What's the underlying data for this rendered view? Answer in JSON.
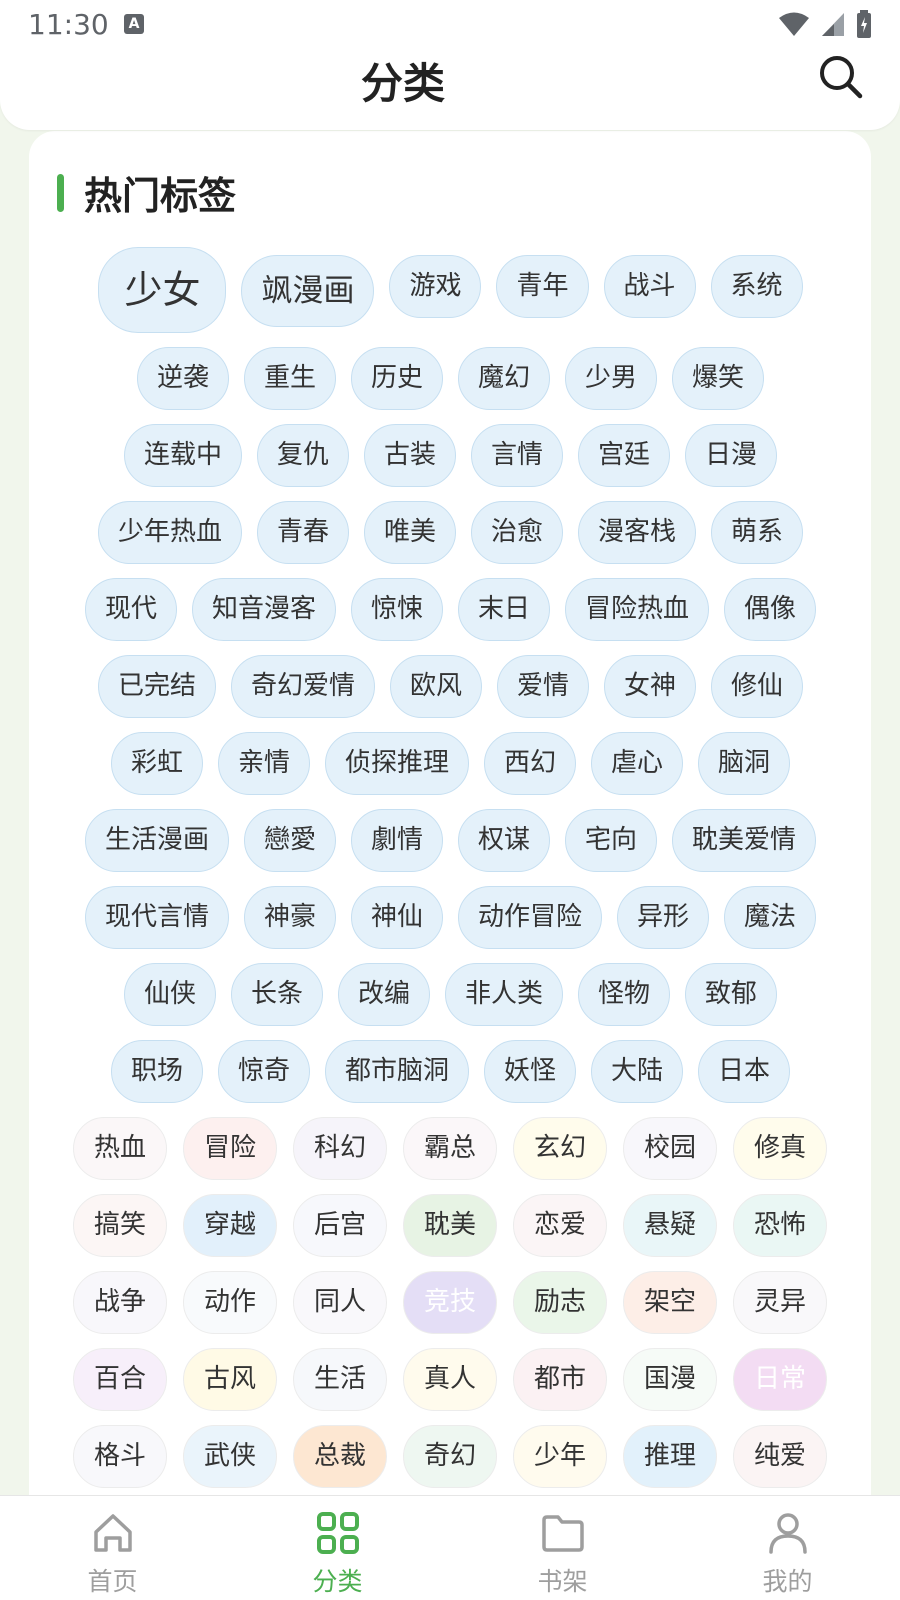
{
  "status": {
    "time": "11:30",
    "app_icon_letter": "A"
  },
  "header": {
    "title": "分类"
  },
  "section": {
    "title": "热门标签"
  },
  "hot_tags": [
    "少女",
    "飒漫画",
    "游戏",
    "青年",
    "战斗",
    "系统",
    "逆袭",
    "重生",
    "历史",
    "魔幻",
    "少男",
    "爆笑",
    "连载中",
    "复仇",
    "古装",
    "言情",
    "宫廷",
    "日漫",
    "少年热血",
    "青春",
    "唯美",
    "治愈",
    "漫客栈",
    "萌系",
    "现代",
    "知音漫客",
    "惊悚",
    "末日",
    "冒险热血",
    "偶像",
    "已完结",
    "奇幻爱情",
    "欧风",
    "爱情",
    "女神",
    "修仙",
    "彩虹",
    "亲情",
    "侦探推理",
    "西幻",
    "虐心",
    "脑洞",
    "生活漫画",
    "戀愛",
    "劇情",
    "权谋",
    "宅向",
    "耽美爱情",
    "现代言情",
    "神豪",
    "神仙",
    "动作冒险",
    "异形",
    "魔法",
    "仙侠",
    "长条",
    "改编",
    "非人类",
    "怪物",
    "致郁",
    "职场",
    "惊奇",
    "都市脑洞",
    "妖怪",
    "大陆",
    "日本"
  ],
  "genre_tags": [
    {
      "label": "热血",
      "bg": "#fbf7f8",
      "fg": "#333333"
    },
    {
      "label": "冒险",
      "bg": "#fdf0ef",
      "fg": "#333333"
    },
    {
      "label": "科幻",
      "bg": "#f6f4fa",
      "fg": "#333333"
    },
    {
      "label": "霸总",
      "bg": "#fbf7f9",
      "fg": "#333333"
    },
    {
      "label": "玄幻",
      "bg": "#fffcec",
      "fg": "#333333"
    },
    {
      "label": "校园",
      "bg": "#f8f7fb",
      "fg": "#333333"
    },
    {
      "label": "修真",
      "bg": "#fffcec",
      "fg": "#333333"
    },
    {
      "label": "搞笑",
      "bg": "#fcf6f5",
      "fg": "#333333"
    },
    {
      "label": "穿越",
      "bg": "#e2f0fb",
      "fg": "#333333"
    },
    {
      "label": "后宫",
      "bg": "#f7f8fc",
      "fg": "#333333"
    },
    {
      "label": "耽美",
      "bg": "#e7f3e4",
      "fg": "#333333"
    },
    {
      "label": "恋爱",
      "bg": "#fbf5f6",
      "fg": "#333333"
    },
    {
      "label": "悬疑",
      "bg": "#e9f6f8",
      "fg": "#333333"
    },
    {
      "label": "恐怖",
      "bg": "#eaf7f4",
      "fg": "#333333"
    },
    {
      "label": "战争",
      "bg": "#f8f7fb",
      "fg": "#333333"
    },
    {
      "label": "动作",
      "bg": "#f8fafc",
      "fg": "#333333"
    },
    {
      "label": "同人",
      "bg": "#f9f8fb",
      "fg": "#333333"
    },
    {
      "label": "竞技",
      "bg": "#e4def6",
      "fg": "#ffffff"
    },
    {
      "label": "励志",
      "bg": "#eaf6e9",
      "fg": "#333333"
    },
    {
      "label": "架空",
      "bg": "#fdeee7",
      "fg": "#333333"
    },
    {
      "label": "灵异",
      "bg": "#f9f8fa",
      "fg": "#333333"
    },
    {
      "label": "百合",
      "bg": "#f7effa",
      "fg": "#333333"
    },
    {
      "label": "古风",
      "bg": "#fffae6",
      "fg": "#333333"
    },
    {
      "label": "生活",
      "bg": "#f6f8fb",
      "fg": "#333333"
    },
    {
      "label": "真人",
      "bg": "#fffbed",
      "fg": "#333333"
    },
    {
      "label": "都市",
      "bg": "#fbf1f3",
      "fg": "#333333"
    },
    {
      "label": "国漫",
      "bg": "#f6fbf7",
      "fg": "#333333"
    },
    {
      "label": "日常",
      "bg": "#f3dcf3",
      "fg": "#ffffff"
    },
    {
      "label": "格斗",
      "bg": "#f8f8fb",
      "fg": "#333333"
    },
    {
      "label": "武侠",
      "bg": "#eaf4fb",
      "fg": "#333333"
    },
    {
      "label": "总裁",
      "bg": "#fde7d2",
      "fg": "#333333"
    },
    {
      "label": "奇幻",
      "bg": "#eef7f1",
      "fg": "#333333"
    },
    {
      "label": "少年",
      "bg": "#fffbee",
      "fg": "#333333"
    },
    {
      "label": "推理",
      "bg": "#e2f1fb",
      "fg": "#333333"
    },
    {
      "label": "纯爱",
      "bg": "#fbf4f4",
      "fg": "#333333"
    }
  ],
  "tabs": [
    {
      "label": "首页",
      "icon": "home-icon",
      "active": false
    },
    {
      "label": "分类",
      "icon": "grid-icon",
      "active": true
    },
    {
      "label": "书架",
      "icon": "folder-icon",
      "active": false
    },
    {
      "label": "我的",
      "icon": "user-icon",
      "active": false
    }
  ],
  "colors": {
    "accent": "#4caf50",
    "inactive_tab": "#9e9e9e",
    "hot_tag_bg": "#e4f1fa"
  }
}
